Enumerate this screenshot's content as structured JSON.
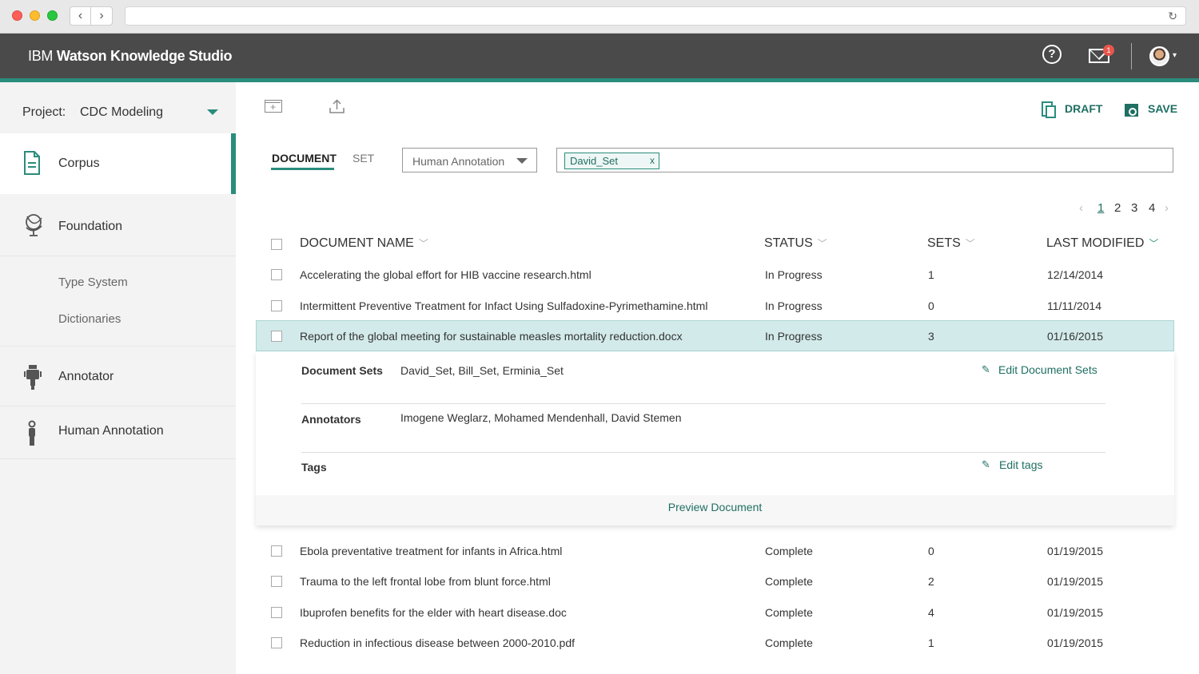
{
  "app": {
    "brand_ibm": "IBM",
    "brand_product": "Watson Knowledge Studio",
    "notification_count": "1"
  },
  "colors": {
    "accent": "#2a8c7c",
    "accent_dark": "#1f6f63",
    "header_bg": "#4a4a4a",
    "selected_row": "#d3eaea"
  },
  "sidebar": {
    "project_label": "Project:",
    "project_name": "CDC Modeling",
    "items": [
      {
        "label": "Corpus",
        "icon": "document-icon",
        "active": true
      },
      {
        "label": "Foundation",
        "icon": "globe-icon"
      },
      {
        "label": "Type System",
        "sub": true
      },
      {
        "label": "Dictionaries",
        "sub": true
      },
      {
        "label": "Annotator",
        "icon": "robot-icon"
      },
      {
        "label": "Human Annotation",
        "icon": "person-icon"
      }
    ]
  },
  "toolbar": {
    "draft_label": "DRAFT",
    "save_label": "SAVE",
    "icons": [
      "add-document-icon",
      "upload-icon"
    ]
  },
  "filters": {
    "tabs": [
      "DOCUMENT",
      "SET"
    ],
    "active_tab": "DOCUMENT",
    "annotation_select": "Human Annotation",
    "chips": [
      "David_Set"
    ],
    "chip_remove": "x"
  },
  "pagination": {
    "pages": [
      "1",
      "2",
      "3",
      "4"
    ],
    "current": "1"
  },
  "table": {
    "columns": [
      "DOCUMENT NAME",
      "STATUS",
      "SETS",
      "LAST MODIFIED"
    ],
    "rows": [
      {
        "name": "Accelerating the global effort for HIB vaccine research.html",
        "status": "In Progress",
        "sets": "1",
        "modified": "12/14/2014"
      },
      {
        "name": "Intermittent Preventive Treatment for Infact Using Sulfadoxine-Pyrimethamine.html",
        "status": "In Progress",
        "sets": "0",
        "modified": "11/11/2014"
      },
      {
        "name": "Report of the global meeting for sustainable measles mortality reduction.docx",
        "status": "In Progress",
        "sets": "3",
        "modified": "01/16/2015",
        "selected": true
      },
      {
        "name": "Ebola preventative treatment for infants in Africa.html",
        "status": "Complete",
        "sets": "0",
        "modified": "01/19/2015"
      },
      {
        "name": "Trauma to the left frontal lobe from blunt force.html",
        "status": "Complete",
        "sets": "2",
        "modified": "01/19/2015"
      },
      {
        "name": "Ibuprofen benefits for the elder with heart disease.doc",
        "status": "Complete",
        "sets": "4",
        "modified": "01/19/2015"
      },
      {
        "name": "Reduction in infectious disease between 2000-2010.pdf",
        "status": "Complete",
        "sets": "1",
        "modified": "01/19/2015"
      }
    ]
  },
  "details": {
    "sets_label": "Document Sets",
    "sets_value": "David_Set, Bill_Set, Erminia_Set",
    "edit_sets": "Edit Document Sets",
    "annotators_label": "Annotators",
    "annotators_value": "Imogene Weglarz, Mohamed Mendenhall, David Stemen",
    "tags_label": "Tags",
    "edit_tags": "Edit tags",
    "preview": "Preview Document"
  }
}
